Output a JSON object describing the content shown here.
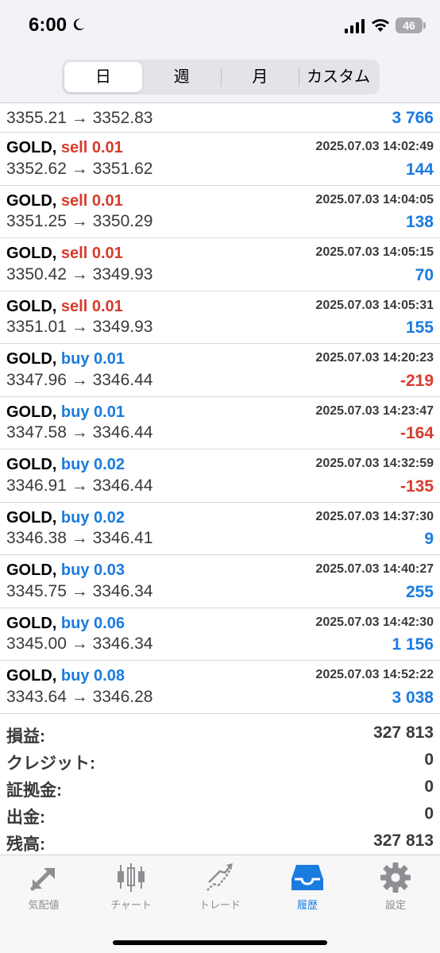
{
  "status_bar": {
    "time": "6:00",
    "battery": "46"
  },
  "period_tabs": [
    {
      "label": "日",
      "active": true
    },
    {
      "label": "週",
      "active": false
    },
    {
      "label": "月",
      "active": false
    },
    {
      "label": "カスタム",
      "active": false
    }
  ],
  "partial_row": {
    "prices": "3355.21 → 3352.83",
    "profit": "3 766"
  },
  "deals": [
    {
      "symbol": "GOLD,",
      "side": "sell 0.01",
      "time": "2025.07.03 14:02:49",
      "prices": "3352.62 → 3351.62",
      "profit": "144"
    },
    {
      "symbol": "GOLD,",
      "side": "sell 0.01",
      "time": "2025.07.03 14:04:05",
      "prices": "3351.25 → 3350.29",
      "profit": "138"
    },
    {
      "symbol": "GOLD,",
      "side": "sell 0.01",
      "time": "2025.07.03 14:05:15",
      "prices": "3350.42 → 3349.93",
      "profit": "70"
    },
    {
      "symbol": "GOLD,",
      "side": "sell 0.01",
      "time": "2025.07.03 14:05:31",
      "prices": "3351.01 → 3349.93",
      "profit": "155"
    },
    {
      "symbol": "GOLD,",
      "side": "buy 0.01",
      "time": "2025.07.03 14:20:23",
      "prices": "3347.96 → 3346.44",
      "profit": "-219"
    },
    {
      "symbol": "GOLD,",
      "side": "buy 0.01",
      "time": "2025.07.03 14:23:47",
      "prices": "3347.58 → 3346.44",
      "profit": "-164"
    },
    {
      "symbol": "GOLD,",
      "side": "buy 0.02",
      "time": "2025.07.03 14:32:59",
      "prices": "3346.91 → 3346.44",
      "profit": "-135"
    },
    {
      "symbol": "GOLD,",
      "side": "buy 0.02",
      "time": "2025.07.03 14:37:30",
      "prices": "3346.38 → 3346.41",
      "profit": "9"
    },
    {
      "symbol": "GOLD,",
      "side": "buy 0.03",
      "time": "2025.07.03 14:40:27",
      "prices": "3345.75 → 3346.34",
      "profit": "255"
    },
    {
      "symbol": "GOLD,",
      "side": "buy 0.06",
      "time": "2025.07.03 14:42:30",
      "prices": "3345.00 → 3346.34",
      "profit": "1 156"
    },
    {
      "symbol": "GOLD,",
      "side": "buy 0.08",
      "time": "2025.07.03 14:52:22",
      "prices": "3343.64 → 3346.28",
      "profit": "3 038"
    }
  ],
  "summary": [
    {
      "label": "損益:",
      "value": "327 813"
    },
    {
      "label": "クレジット:",
      "value": "0"
    },
    {
      "label": "証拠金:",
      "value": "0"
    },
    {
      "label": "出金:",
      "value": "0"
    },
    {
      "label": "残高:",
      "value": "327 813"
    }
  ],
  "tab_bar": [
    {
      "label": "気配値",
      "icon": "quotes-icon",
      "active": false
    },
    {
      "label": "チャート",
      "icon": "candlestick-chart-icon",
      "active": false
    },
    {
      "label": "トレード",
      "icon": "trade-icon",
      "active": false
    },
    {
      "label": "履歴",
      "icon": "history-inbox-icon",
      "active": true
    },
    {
      "label": "設定",
      "icon": "gear-icon",
      "active": false
    }
  ],
  "colors": {
    "buy": "#1a7be0",
    "sell": "#d93a2b",
    "tab_active": "#1a7be0",
    "tab_inactive": "#8e8e93"
  }
}
